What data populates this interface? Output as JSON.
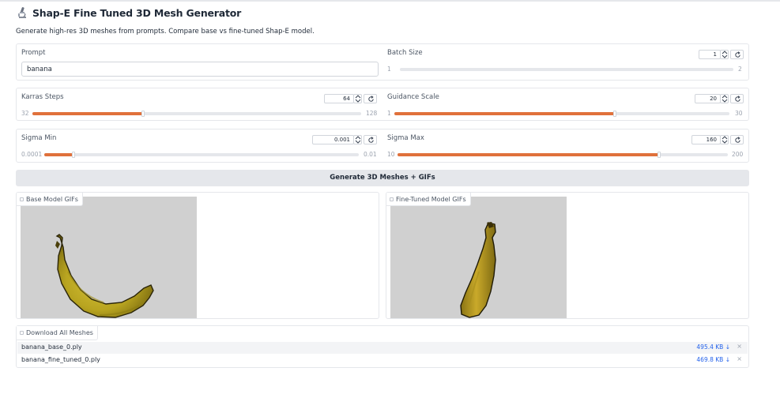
{
  "header": {
    "title": "Shap-E Fine Tuned 3D Mesh Generator",
    "subtitle": "Generate high-res 3D meshes from prompts. Compare base vs fine-tuned Shap-E model."
  },
  "controls": {
    "prompt": {
      "label": "Prompt",
      "value": "banana"
    },
    "batch_size": {
      "label": "Batch Size",
      "value": "1",
      "min": "1",
      "max": "2",
      "fraction": 0.0
    },
    "karras_steps": {
      "label": "Karras Steps",
      "value": "64",
      "min": "32",
      "max": "128",
      "fraction": 0.333
    },
    "guidance_scale": {
      "label": "Guidance Scale",
      "value": "20",
      "min": "1",
      "max": "30",
      "fraction": 0.655
    },
    "sigma_min": {
      "label": "Sigma Min",
      "value": "0.001",
      "min": "0.0001",
      "max": "0.01",
      "fraction": 0.091
    },
    "sigma_max": {
      "label": "Sigma Max",
      "value": "160",
      "min": "10",
      "max": "200",
      "fraction": 0.789
    }
  },
  "generate_button": {
    "label": "Generate 3D Meshes + GIFs"
  },
  "galleries": {
    "base": {
      "label": "Base Model GIFs"
    },
    "fine_tuned": {
      "label": "Fine-Tuned Model GIFs"
    }
  },
  "downloads": {
    "label": "Download All Meshes",
    "files": [
      {
        "name": "banana_base_0.ply",
        "size": "495.4 KB ↓"
      },
      {
        "name": "banana_fine_tuned_0.ply",
        "size": "469.8 KB ↓"
      }
    ],
    "remove_glyph": "×"
  },
  "colors": {
    "accent": "#e0713b",
    "link": "#2563eb",
    "button_bg": "#e5e7eb"
  },
  "icons": [
    "microscope-icon",
    "spin-arrows-icon",
    "reset-icon",
    "image-icon",
    "file-icon",
    "close-icon"
  ]
}
